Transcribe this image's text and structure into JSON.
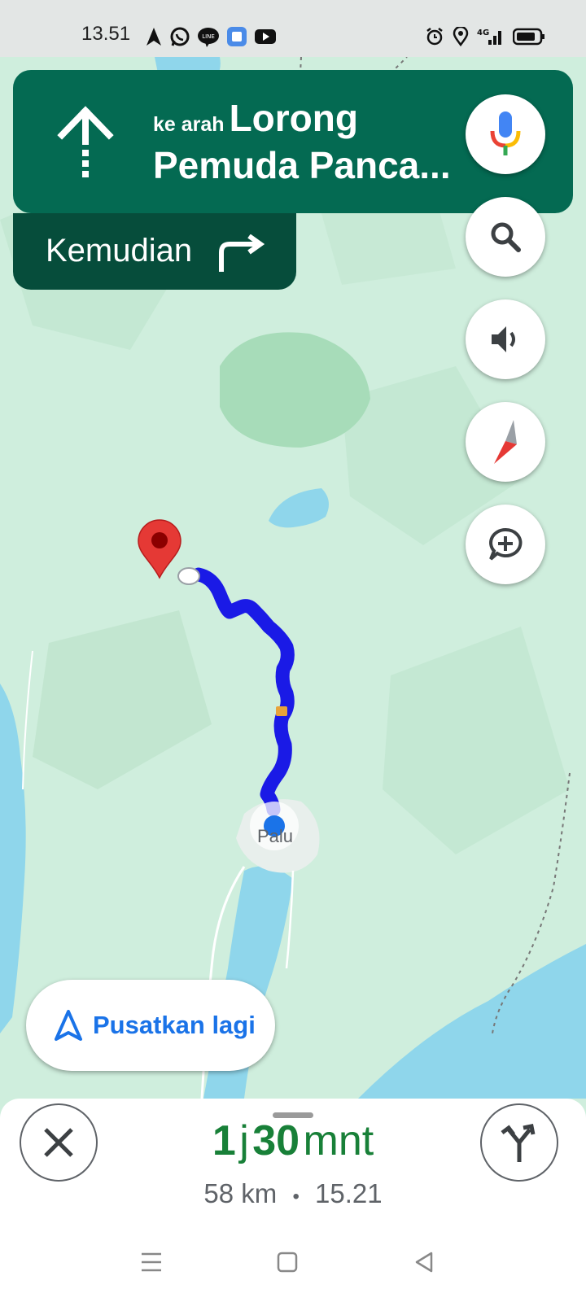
{
  "status_bar": {
    "time": "13.51",
    "left_icons": [
      "navigation-arrow-icon",
      "whatsapp-icon",
      "line-icon",
      "app-icon",
      "youtube-icon"
    ],
    "right_icons": [
      "alarm-icon",
      "location-icon",
      "4g-signal-icon",
      "battery-icon"
    ],
    "network_label": "4G"
  },
  "navigation": {
    "direction_icon": "straight-arrow-icon",
    "toward_prefix": "ke arah",
    "road_line1": "Lorong",
    "road_line2": "Pemuda Panca...",
    "then_label": "Kemudian",
    "then_icon": "turn-right-icon"
  },
  "map": {
    "city_label": "Palu",
    "route_color": "#1a1ae6",
    "land_color": "#cfeedd",
    "water_color": "#8fd6eb",
    "destination_pin_color": "#e53935"
  },
  "controls": {
    "mic_icon": "microphone-icon",
    "search_icon": "search-icon",
    "sound_icon": "volume-icon",
    "compass_icon": "compass-icon",
    "report_icon": "add-report-icon"
  },
  "recenter": {
    "label": "Pusatkan lagi"
  },
  "trip": {
    "hours": "1",
    "hours_unit": "j",
    "minutes": "30",
    "minutes_unit": "mnt",
    "distance": "58 km",
    "separator": "•",
    "arrival": "15.21",
    "eta_color": "#188038"
  },
  "system_nav": {
    "menu_icon": "menu-icon",
    "home_icon": "home-square-icon",
    "back_icon": "back-triangle-icon"
  }
}
